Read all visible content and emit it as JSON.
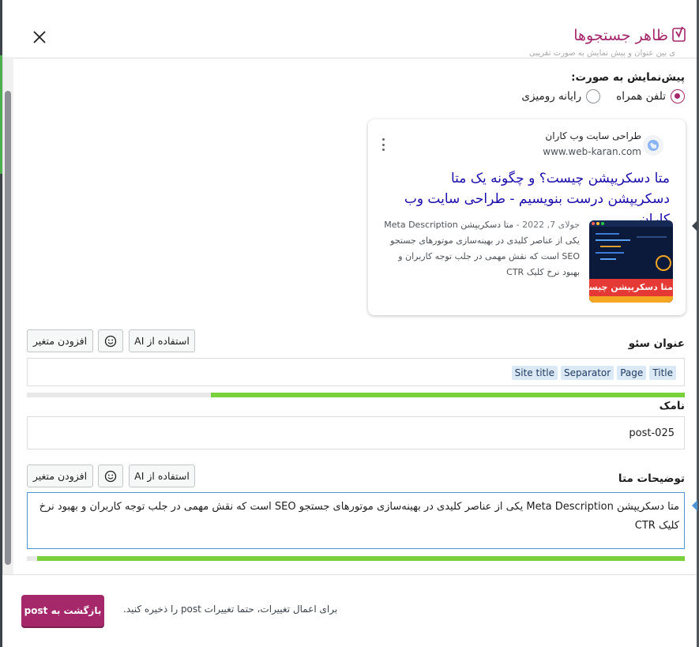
{
  "modal": {
    "title": "ظاهر جستجوها",
    "faded_line": "ی بین عنوان و پیش نمایش به صورت تقریبی"
  },
  "preview": {
    "label": "پیش‌نمایش به صورت:",
    "options": [
      {
        "label": "تلفن همراه",
        "selected": true
      },
      {
        "label": "رایانه رومیزی",
        "selected": false
      }
    ]
  },
  "snippet": {
    "site_name": "طراحی سایت وب کاران",
    "site_url": "www.web-karan.com",
    "title": "متا دسکریپشن چیست؟ و چگونه یک متا دسکریپشن درست بنویسیم - طراحی سایت وب کاران",
    "date": "جولای 7, 2022",
    "date_separator": "-",
    "description": "متا دسکریپشن Meta Description یکی از عناصر کلیدی در بهینه‌سازی موتورهای جستجو SEO است که نقش مهمی در جلب توجه کاربران و بهبود نرخ کلیک CTR",
    "thumbnail_caption": "متا دسکریپشن چیست؟"
  },
  "buttons": {
    "use_ai": "استفاده از AI",
    "add_variable": "افزودن متغیر",
    "emoji_icon": "smiley-icon"
  },
  "seo_title": {
    "label": "عنوان سئو",
    "pills": [
      "Title",
      "Page",
      "Separator",
      "Site title"
    ],
    "progress": 0.72
  },
  "slug": {
    "label": "نامک",
    "value": "post-025"
  },
  "meta_description": {
    "label": "توضیحات متا",
    "value": "متا دسکریپشن Meta Description یکی از عناصر کلیدی در بهینه‌سازی موتورهای جستجو SEO است که نقش مهمی در جلب توجه کاربران و بهبود نرخ کلیک CTR",
    "progress": 0.985
  },
  "footer": {
    "note": "برای اعمال تغییرات، حتما تغییرات post را ذخیره کنید.",
    "return_button": "بازگشت به post"
  },
  "colors": {
    "brand": "#a4286a",
    "link": "#1a0dab",
    "progress_good": "#7ad03a",
    "focus": "#4f94d4"
  }
}
